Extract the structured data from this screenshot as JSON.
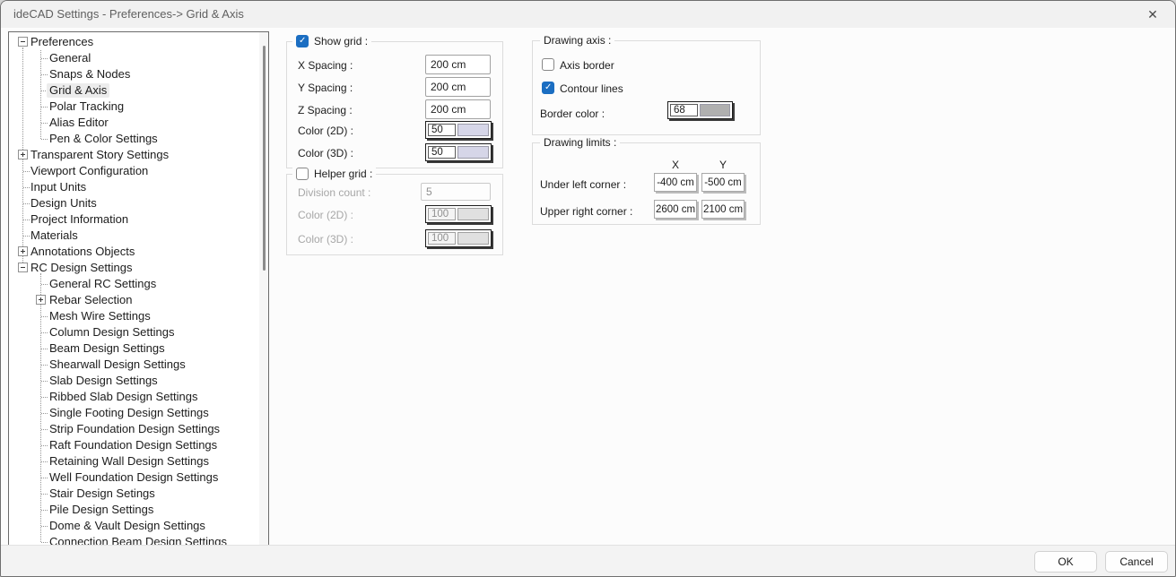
{
  "window": {
    "title": "ideCAD Settings - Preferences-> Grid & Axis",
    "close_icon": "✕"
  },
  "colors": {
    "accent": "#1b6ec2",
    "grid_color_2d": "#d6d6e8",
    "grid_color_3d": "#d6d6e8",
    "helper_color_2d": "#e0e0e0",
    "helper_color_3d": "#e0e0e0",
    "border_color_swatch": "#b0b0b0"
  },
  "tree": {
    "items": [
      {
        "label": "Preferences",
        "level": 0,
        "expand": "minus"
      },
      {
        "label": "General",
        "level": 1
      },
      {
        "label": "Snaps & Nodes",
        "level": 1
      },
      {
        "label": "Grid & Axis",
        "level": 1,
        "selected": true
      },
      {
        "label": "Polar Tracking",
        "level": 1
      },
      {
        "label": "Alias Editor",
        "level": 1
      },
      {
        "label": "Pen & Color Settings",
        "level": 1
      },
      {
        "label": "Transparent Story Settings",
        "level": 0,
        "expand": "plus"
      },
      {
        "label": "Viewport Configuration",
        "level": 0
      },
      {
        "label": "Input Units",
        "level": 0
      },
      {
        "label": "Design Units",
        "level": 0
      },
      {
        "label": "Project Information",
        "level": 0
      },
      {
        "label": "Materials",
        "level": 0
      },
      {
        "label": "Annotations Objects",
        "level": 0,
        "expand": "plus"
      },
      {
        "label": "RC Design Settings",
        "level": 0,
        "expand": "minus"
      },
      {
        "label": "General RC Settings",
        "level": 1
      },
      {
        "label": "Rebar Selection",
        "level": 1,
        "expand": "plus"
      },
      {
        "label": "Mesh Wire Settings",
        "level": 1
      },
      {
        "label": "Column Design Settings",
        "level": 1
      },
      {
        "label": "Beam Design Settings",
        "level": 1
      },
      {
        "label": "Shearwall Design Settings",
        "level": 1
      },
      {
        "label": "Slab Design Settings",
        "level": 1
      },
      {
        "label": "Ribbed Slab Design Settings",
        "level": 1
      },
      {
        "label": "Single Footing Design Settings",
        "level": 1
      },
      {
        "label": "Strip Foundation Design Settings",
        "level": 1
      },
      {
        "label": "Raft Foundation Design Settings",
        "level": 1
      },
      {
        "label": "Retaining Wall Design Settings",
        "level": 1
      },
      {
        "label": "Well Foundation Design Settings",
        "level": 1
      },
      {
        "label": "Stair Design Setings",
        "level": 1
      },
      {
        "label": "Pile Design Settings",
        "level": 1
      },
      {
        "label": "Dome & Vault Design Settings",
        "level": 1
      },
      {
        "label": "Connection Beam Design Settings",
        "level": 1
      }
    ]
  },
  "show_grid": {
    "legend": "Show grid :",
    "checked": true,
    "x_spacing": {
      "label": "X Spacing :",
      "value": "200 cm"
    },
    "y_spacing": {
      "label": "Y Spacing :",
      "value": "200 cm"
    },
    "z_spacing": {
      "label": "Z Spacing :",
      "value": "200 cm"
    },
    "color_2d": {
      "label": "Color (2D) :",
      "value": "50"
    },
    "color_3d": {
      "label": "Color (3D) :",
      "value": "50"
    }
  },
  "helper_grid": {
    "legend": "Helper grid :",
    "checked": false,
    "division_count": {
      "label": "Division count :",
      "value": "5"
    },
    "color_2d": {
      "label": "Color (2D) :",
      "value": "100"
    },
    "color_3d": {
      "label": "Color (3D) :",
      "value": "100"
    }
  },
  "drawing_axis": {
    "legend": "Drawing axis :",
    "axis_border": {
      "label": "Axis border",
      "checked": false
    },
    "contour_lines": {
      "label": "Contour lines",
      "checked": true
    },
    "border_color": {
      "label": "Border color :",
      "value": "68"
    }
  },
  "drawing_limits": {
    "legend": "Drawing limits :",
    "col_x": "X",
    "col_y": "Y",
    "under_left": {
      "label": "Under left corner :",
      "x": "-400 cm",
      "y": "-500 cm"
    },
    "upper_right": {
      "label": "Upper right corner :",
      "x": "2600 cm",
      "y": "2100 cm"
    }
  },
  "footer": {
    "ok": "OK",
    "cancel": "Cancel"
  }
}
